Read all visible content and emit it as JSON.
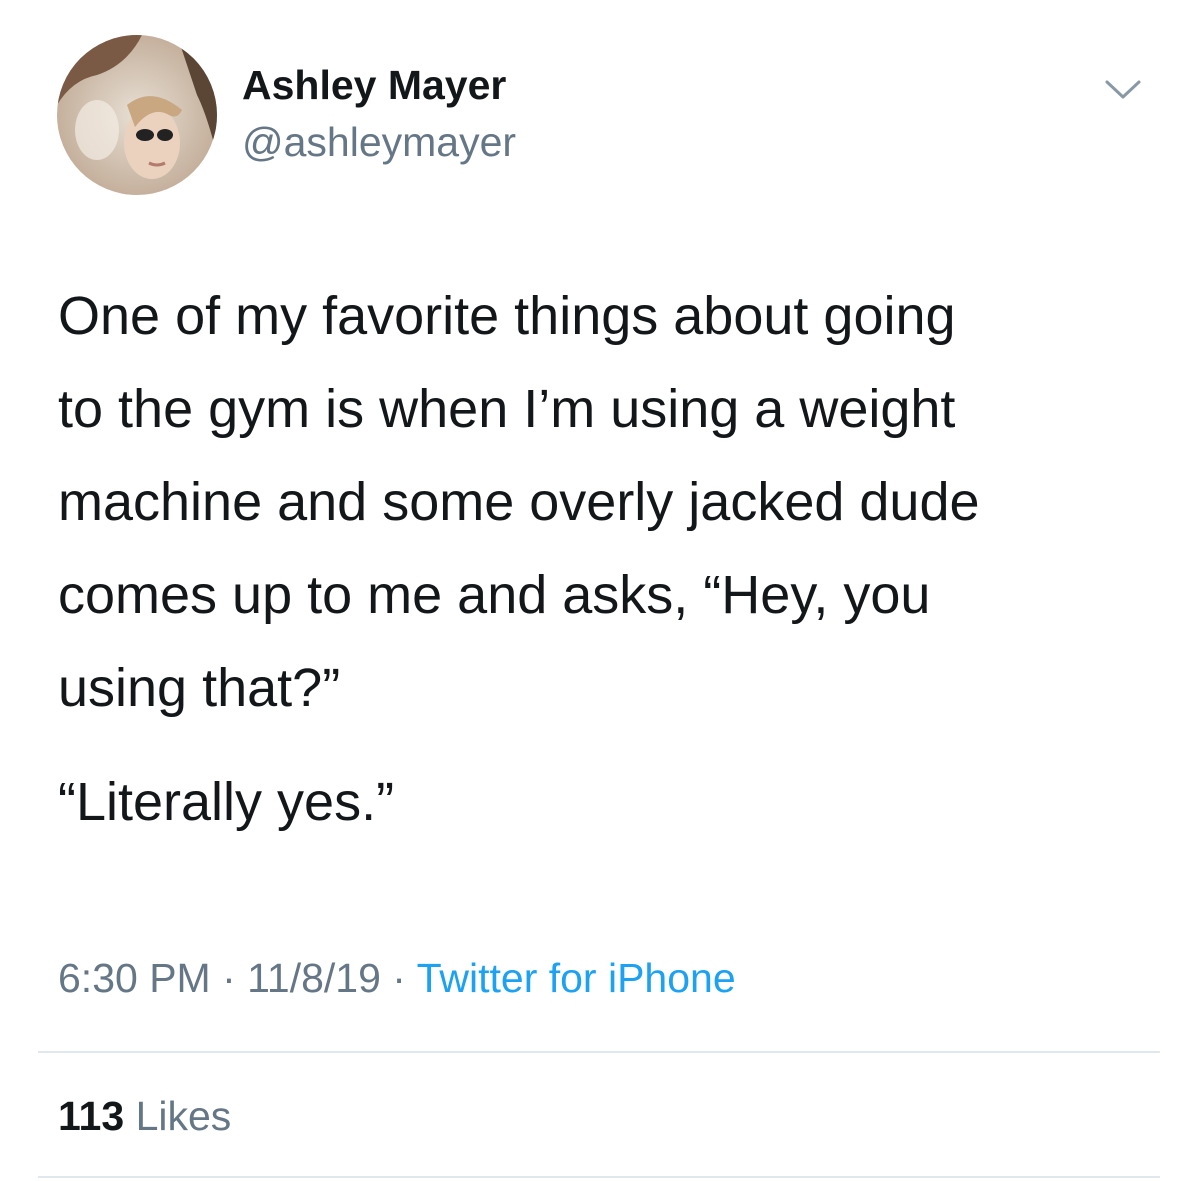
{
  "author": {
    "display_name": "Ashley Mayer",
    "handle": "@ashleymayer"
  },
  "tweet": {
    "text": "One of my favorite things about going\nto the gym is when I’m using a weight\nmachine and some overly jacked dude\ncomes up to me and asks, “Hey, you\nusing that?”",
    "reply": "“Literally yes.”"
  },
  "meta": {
    "time": "6:30 PM",
    "separator": " · ",
    "date": "11/8/19",
    "source": "Twitter for iPhone"
  },
  "stats": {
    "likes_count": "113",
    "likes_label": "Likes"
  },
  "icons": {
    "menu": "chevron-down-icon",
    "avatar": "profile-photo"
  },
  "colors": {
    "text": "#14171a",
    "secondary": "#657786",
    "link": "#1da1f2",
    "divider": "#e1e8ed"
  }
}
